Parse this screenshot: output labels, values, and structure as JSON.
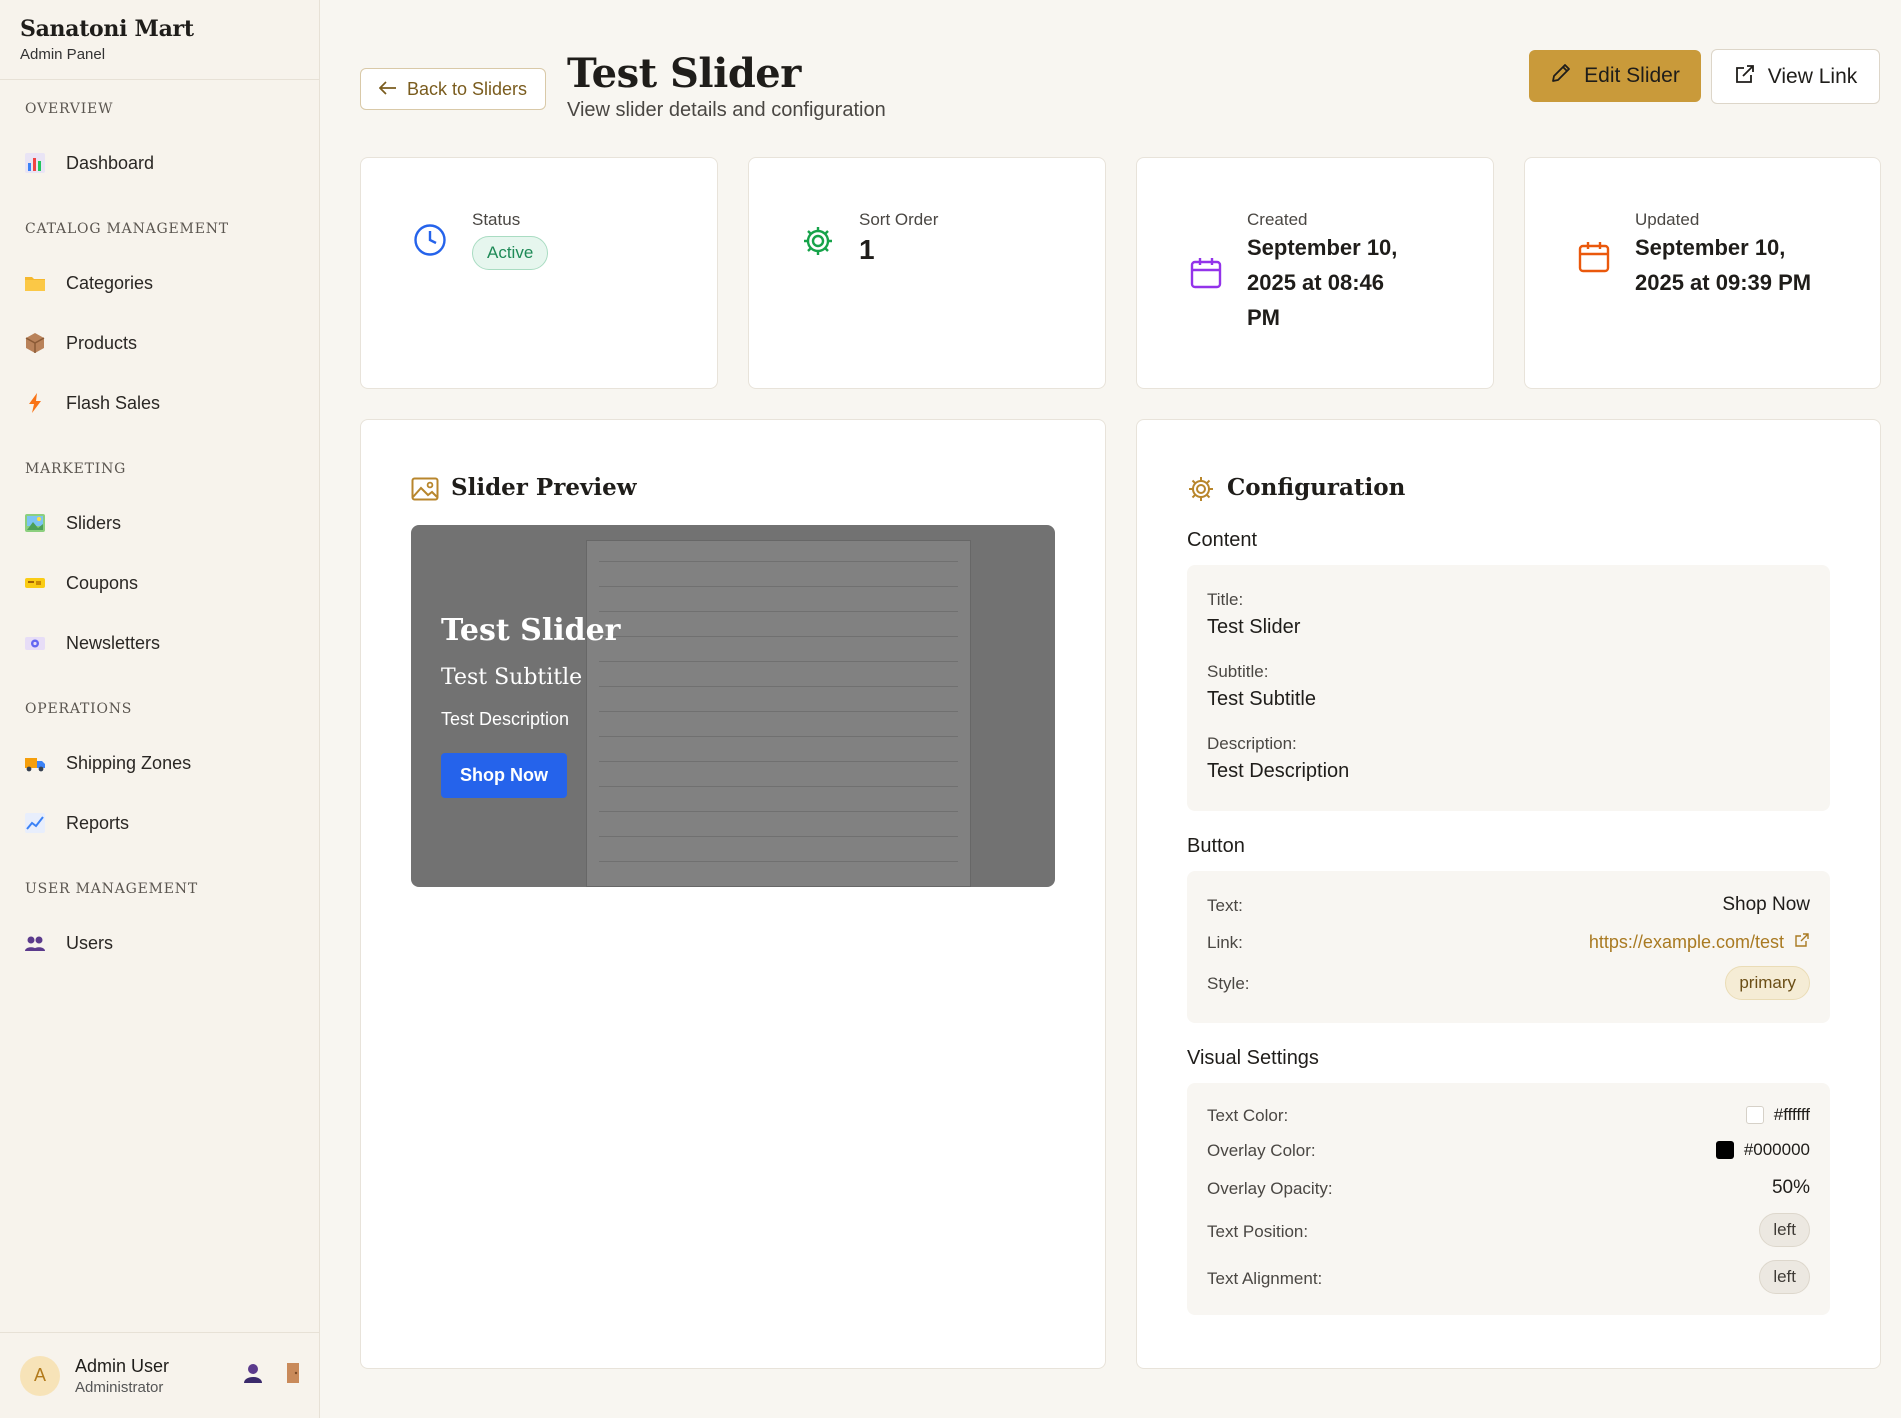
{
  "brand": {
    "name": "Sanatoni Mart",
    "subtitle": "Admin Panel"
  },
  "sidebar": {
    "sections": [
      {
        "title": "OVERVIEW",
        "items": [
          {
            "label": "Dashboard",
            "icon": "bar-chart-icon"
          }
        ]
      },
      {
        "title": "CATALOG MANAGEMENT",
        "items": [
          {
            "label": "Categories",
            "icon": "folder-icon"
          },
          {
            "label": "Products",
            "icon": "package-icon"
          },
          {
            "label": "Flash Sales",
            "icon": "lightning-icon"
          }
        ]
      },
      {
        "title": "MARKETING",
        "items": [
          {
            "label": "Sliders",
            "icon": "image-icon"
          },
          {
            "label": "Coupons",
            "icon": "ticket-icon"
          },
          {
            "label": "Newsletters",
            "icon": "newsletter-icon"
          }
        ]
      },
      {
        "title": "OPERATIONS",
        "items": [
          {
            "label": "Shipping Zones",
            "icon": "truck-icon"
          },
          {
            "label": "Reports",
            "icon": "line-chart-icon"
          }
        ]
      },
      {
        "title": "USER MANAGEMENT",
        "items": [
          {
            "label": "Users",
            "icon": "users-icon"
          }
        ]
      }
    ]
  },
  "user": {
    "initial": "A",
    "name": "Admin User",
    "role": "Administrator"
  },
  "header": {
    "back_label": "Back to Sliders",
    "title": "Test Slider",
    "subtitle": "View slider details and configuration",
    "edit_label": "Edit Slider",
    "view_label": "View Link"
  },
  "stats": {
    "status": {
      "label": "Status",
      "value": "Active"
    },
    "sort_order": {
      "label": "Sort Order",
      "value": "1"
    },
    "created": {
      "label": "Created",
      "line1": "September 10,",
      "line2": "2025 at 08:46",
      "line3": "PM"
    },
    "updated": {
      "label": "Updated",
      "line1": "September 10,",
      "line2": "2025 at 09:39 PM"
    }
  },
  "preview": {
    "title": "Slider Preview",
    "slide_title": "Test Slider",
    "slide_subtitle": "Test Subtitle",
    "slide_description": "Test Description",
    "slide_button": "Shop Now"
  },
  "config": {
    "title": "Configuration",
    "content_heading": "Content",
    "content": {
      "title_label": "Title:",
      "title_value": "Test Slider",
      "subtitle_label": "Subtitle:",
      "subtitle_value": "Test Subtitle",
      "description_label": "Description:",
      "description_value": "Test Description"
    },
    "button_heading": "Button",
    "button": {
      "text_label": "Text:",
      "text_value": "Shop Now",
      "link_label": "Link:",
      "link_value": "https://example.com/test",
      "style_label": "Style:",
      "style_value": "primary"
    },
    "visual_heading": "Visual Settings",
    "visual": {
      "text_color_label": "Text Color:",
      "text_color_value": "#ffffff",
      "overlay_color_label": "Overlay Color:",
      "overlay_color_value": "#000000",
      "overlay_opacity_label": "Overlay Opacity:",
      "overlay_opacity_value": "50%",
      "text_position_label": "Text Position:",
      "text_position_value": "left",
      "text_alignment_label": "Text Alignment:",
      "text_alignment_value": "left"
    }
  },
  "colors": {
    "accent": "#c99a3a",
    "button_blue": "#2563eb",
    "active_green": "#1e8a57"
  }
}
